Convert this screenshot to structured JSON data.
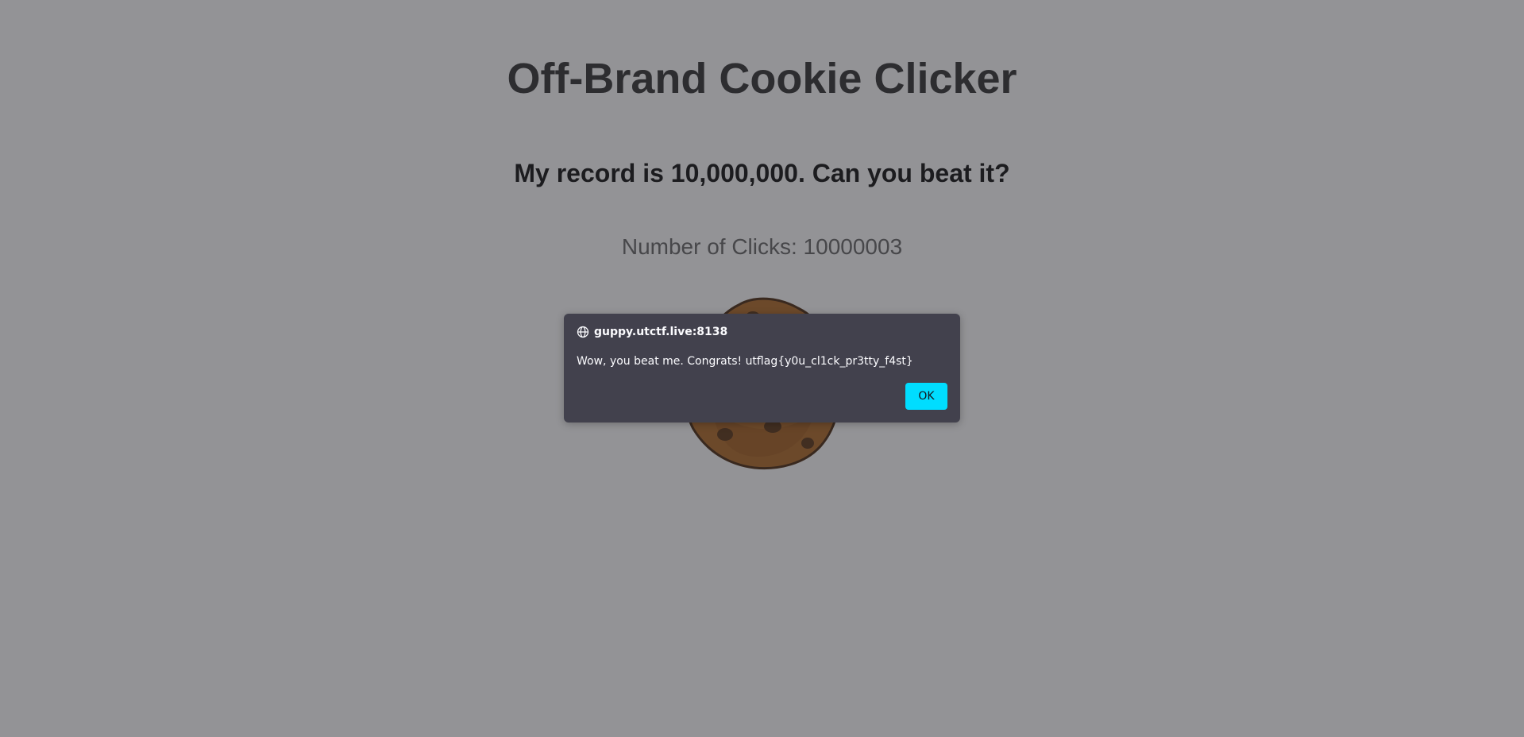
{
  "page": {
    "title": "Off-Brand Cookie Clicker",
    "subtitle": "My record is 10,000,000. Can you beat it?",
    "clicks_text": "Number of Clicks: 10000003"
  },
  "cookie": {
    "icon": "cookie-icon",
    "color": "#b06a26"
  },
  "dialog": {
    "origin": "guppy.utctf.live:8138",
    "origin_icon": "globe-icon",
    "message": "Wow, you beat me. Congrats! utflag{y0u_cl1ck_pr3tty_f4st}",
    "ok_label": "OK",
    "accent_color": "#00ddff",
    "background_color": "#42414d"
  }
}
